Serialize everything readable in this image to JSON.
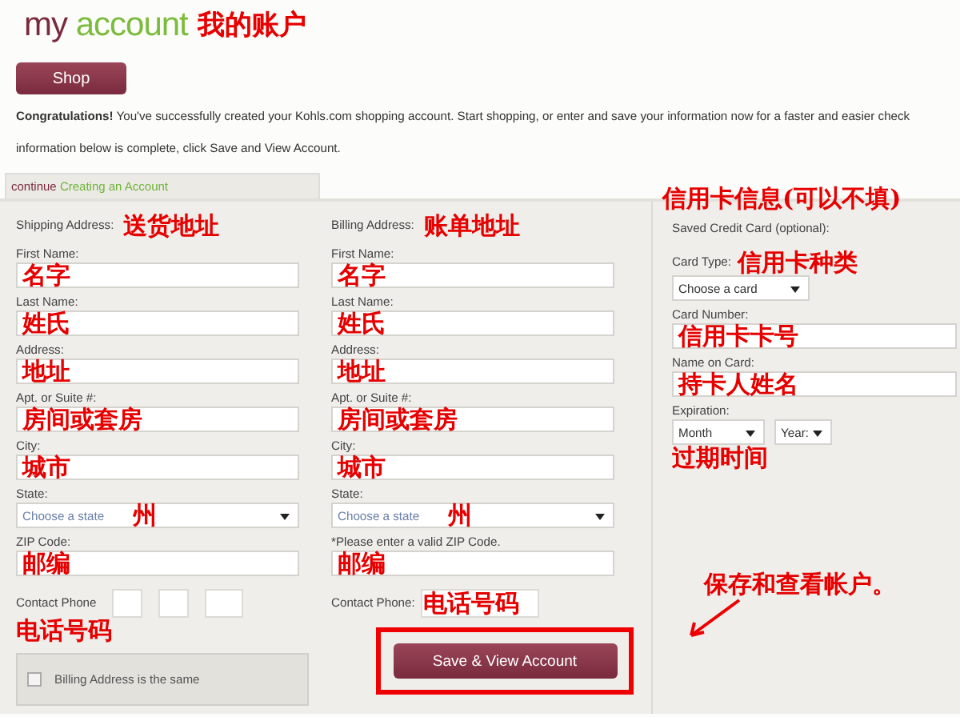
{
  "header": {
    "title_my": "my",
    "title_account": "account",
    "note": "我的账户"
  },
  "shop_button": "Shop",
  "message_lines": [
    "**Congratulations!** You've successfully created your Kohls.com shopping account. Start shopping, or enter and save your information now for a faster and easier check",
    "information below is complete, click Save and View Account."
  ],
  "tab": {
    "prefix": "continue",
    "label": "Creating an Account"
  },
  "shipping": {
    "heading": "Shipping Address:",
    "note": "送货地址",
    "fields": [
      {
        "kind": "text",
        "label": "First Name:",
        "note": "名字"
      },
      {
        "kind": "text",
        "label": "Last Name:",
        "note": "姓氏"
      },
      {
        "kind": "text",
        "label": "Address:",
        "note": "地址"
      },
      {
        "kind": "text",
        "label": "Apt. or Suite #:",
        "note": "房间或套房"
      },
      {
        "kind": "text",
        "label": "City:",
        "note": "城市"
      },
      {
        "kind": "select",
        "label": "State:",
        "placeholder": "Choose a state",
        "note": "州"
      },
      {
        "kind": "text",
        "label": "ZIP Code:",
        "note": "邮编"
      },
      {
        "kind": "phone3",
        "label": "Contact Phone",
        "note": "电话号码"
      }
    ],
    "checkbox": {
      "label": "Billing Address is the same",
      "checked": false
    }
  },
  "billing": {
    "heading": "Billing Address:",
    "note": "账单地址",
    "fields": [
      {
        "kind": "text",
        "label": "First Name:",
        "note": "名字"
      },
      {
        "kind": "text",
        "label": "Last Name:",
        "note": "姓氏"
      },
      {
        "kind": "text",
        "label": "Address:",
        "note": "地址"
      },
      {
        "kind": "text",
        "label": "Apt. or Suite #:",
        "note": "房间或套房"
      },
      {
        "kind": "text",
        "label": "City:",
        "note": "城市"
      },
      {
        "kind": "select",
        "label": "State:",
        "placeholder": "Choose a state",
        "note": "州"
      },
      {
        "kind": "text",
        "label": "*Please enter a valid ZIP Code.",
        "note": "邮编"
      },
      {
        "kind": "phone1",
        "label": "Contact Phone:",
        "note": "电话号码"
      }
    ],
    "save_button": "Save & View Account"
  },
  "credit_card": {
    "note": "信用卡信息(可以不填)",
    "heading": "Saved Credit Card (optional):",
    "fields": [
      {
        "kind": "select",
        "label": "Card Type:",
        "label_note": "信用卡种类",
        "placeholder": "Choose a card"
      },
      {
        "kind": "text",
        "label": "Card Number:",
        "note": "信用卡卡号"
      },
      {
        "kind": "text",
        "label": "Name on Card:",
        "note": "持卡人姓名"
      },
      {
        "kind": "expiry",
        "label": "Expiration:",
        "month": "Month",
        "year": "Year:",
        "note": "过期时间"
      }
    ],
    "save_note": "保存和查看帐户。"
  }
}
